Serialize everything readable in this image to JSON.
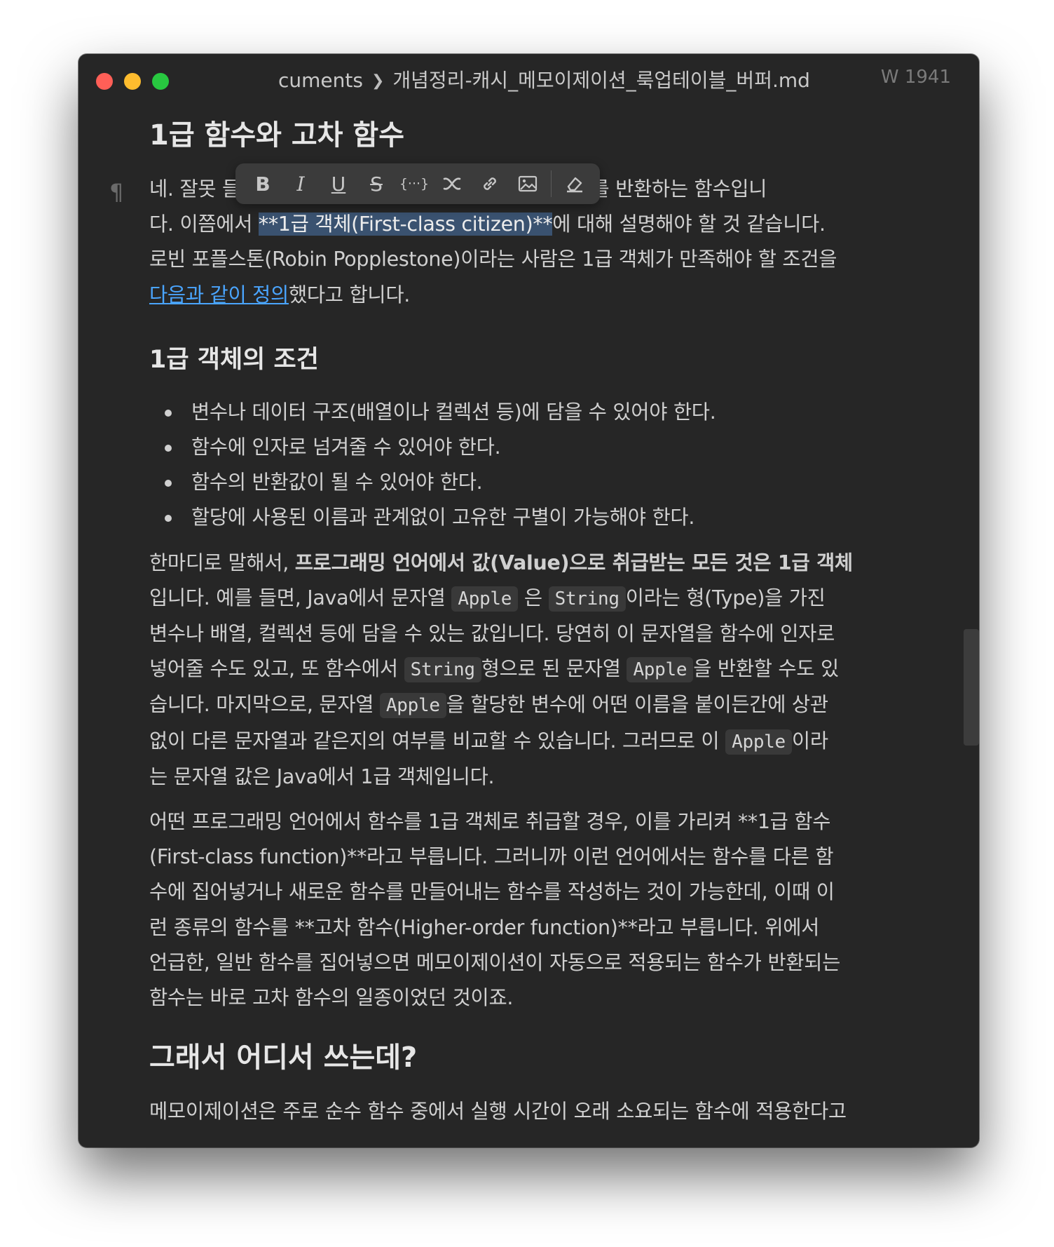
{
  "window": {
    "breadcrumb_parent": "cuments",
    "breadcrumb_file": "개념정리-캐시_메모이제이션_룩업테이블_버퍼.md",
    "word_count": "W 1941"
  },
  "toolbar": {
    "buttons": [
      "bold",
      "italic",
      "underline",
      "strikethrough",
      "inline-code",
      "formula",
      "link",
      "image",
      "clear-format"
    ],
    "bold": "B",
    "italic": "I",
    "underline": "U",
    "strike": "S",
    "code": "{···}"
  },
  "doc": {
    "h_first_class": "1급 함수와 고차 함수",
    "p1_a": "네. 잘못 들",
    "p1_b": "로운 함수를 반환하는 함수입니",
    "p1_c": "다. 이쯤에서 ",
    "p1_sel": "**1급 객체(First-class citizen)**",
    "p1_d": "에 대해 설명해야 할 것 같습니다.",
    "p1_e": "로빈 포플스톤(Robin Popplestone)이라는 사람은 1급 객체가 만족해야 할 조건을",
    "p1_link": "다음과 같이 정의",
    "p1_f": "했다고 합니다.",
    "h_conditions": "1급 객체의 조건",
    "conditions": [
      "변수나 데이터 구조(배열이나 컬렉션 등)에 담을 수 있어야 한다.",
      "함수에 인자로 넘겨줄 수 있어야 한다.",
      "함수의 반환값이 될 수 있어야 한다.",
      "할당에 사용된 이름과 관계없이 고유한 구별이 가능해야 한다."
    ],
    "p2_a": "한마디로 말해서, ",
    "p2_bold": "프로그래밍 언어에서 값(Value)으로 취급받는 모든 것은 1급 객체",
    "p2_b": "입니다. 예를 들면, Java에서 문자열 ",
    "code_apple": "Apple",
    "p2_c": " 은 ",
    "code_string": "String",
    "p2_d": "이라는 형(Type)을 가진",
    "p2_e": "변수나 배열, 컬렉션 등에 담을 수 있는 값입니다. 당연히 이 문자열을 함수에 인자로",
    "p2_f": "넣어줄 수도 있고, 또 함수에서 ",
    "p2_g": "형으로 된 문자열 ",
    "p2_h": "을 반환할 수도 있",
    "p2_i": "습니다. 마지막으로, 문자열 ",
    "p2_j": "을 할당한 변수에 어떤 이름을 붙이든간에 상관",
    "p2_k": "없이 다른 문자열과 같은지의 여부를 비교할 수 있습니다. 그러므로 이 ",
    "p2_l": "이라",
    "p2_m": "는 문자열 값은 Java에서 1급 객체입니다.",
    "p3": [
      "어떤 프로그래밍 언어에서 함수를 1급 객체로 취급할 경우, 이를 가리켜 **1급 함수",
      "(First-class function)**라고 부릅니다. 그러니까 이런 언어에서는 함수를 다른 함",
      "수에 집어넣거나 새로운 함수를 만들어내는 함수를 작성하는 것이 가능한데, 이때 이",
      "런 종류의 함수를 **고차 함수(Higher-order function)**라고 부릅니다. 위에서",
      "언급한, 일반 함수를 집어넣으면 메모이제이션이 자동으로 적용되는 함수가 반환되는",
      "함수는 바로 고차 함수의 일종이었던 것이죠."
    ],
    "h_where": "그래서 어디서 쓰는데?",
    "p4": "메모이제이션은 주로 순수 함수 중에서 실행 시간이 오래 소요되는 함수에 적용한다고"
  }
}
